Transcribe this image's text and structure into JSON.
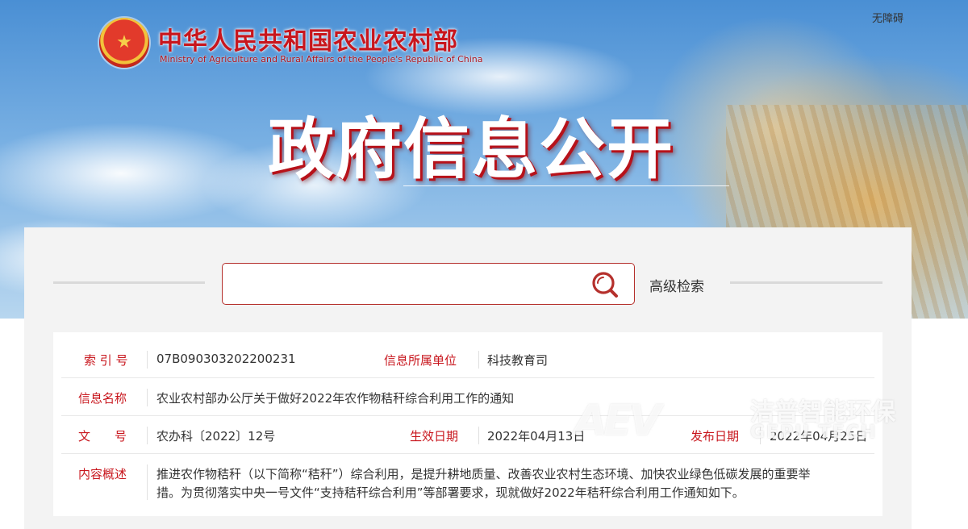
{
  "header": {
    "emblem_glyph": "★",
    "ministry_cn": "中华人民共和国农业农村部",
    "ministry_en": "Ministry of Agriculture and Rural Affairs of the People's Republic of China",
    "accessibility": "无障碍",
    "title": "政府信息公开"
  },
  "search": {
    "placeholder": "",
    "value": "",
    "advanced_label": "高级检索"
  },
  "info": {
    "index_label": "索 引 号",
    "index_value": "07B090303202200231",
    "unit_label": "信息所属单位",
    "unit_value": "科技教育司",
    "name_label": "信息名称",
    "name_value": "农业农村部办公厅关于做好2022年农作物秸秆综合利用工作的通知",
    "docno_label": "文　　号",
    "docno_value": "农办科〔2022〕12号",
    "effective_label": "生效日期",
    "effective_value": "2022年04月13日",
    "publish_label": "发布日期",
    "publish_value": "2022年04月25日",
    "summary_label": "内容概述",
    "summary_line1": "推进农作物秸秆（以下简称“秸秆”）综合利用，是提升耕地质量、改善农业农村生态环境、加快农业绿色低碳发展的重要举",
    "summary_line2": "措。为贯彻落实中央一号文件“支持秸秆综合利用”等部署要求，现就做好2022年秸秆综合利用工作通知如下。"
  },
  "watermark": {
    "logo": "AEV",
    "cn": "洁普智能环保",
    "en": "GEPU TECH"
  },
  "colors": {
    "accent_red": "#c8161d",
    "search_border": "#b5302c"
  }
}
